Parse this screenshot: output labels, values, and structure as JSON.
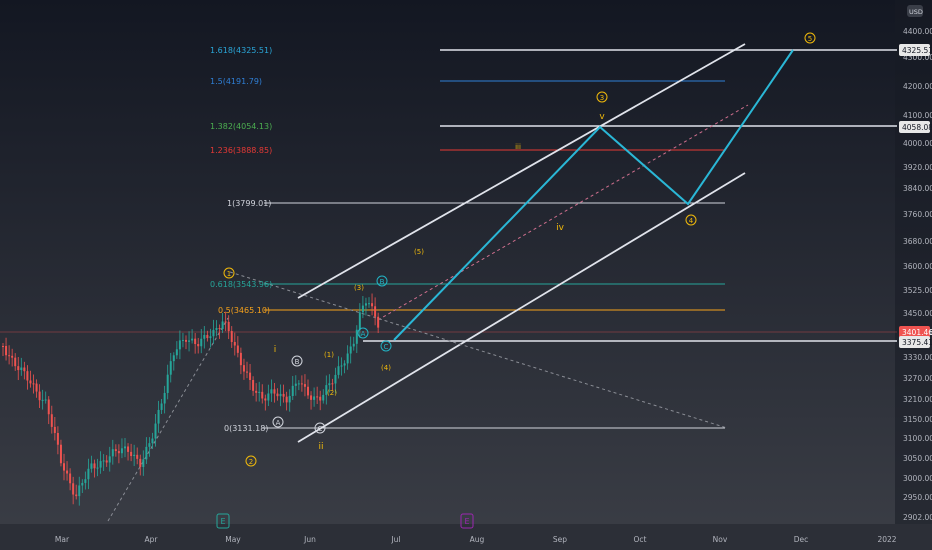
{
  "chart_data": {
    "type": "candlestick",
    "currency": "USD",
    "x_axis": {
      "labels": [
        "Mar",
        "Apr",
        "May",
        "Jun",
        "Jul",
        "Aug",
        "Sep",
        "Oct",
        "Nov",
        "Dec",
        "2022"
      ]
    },
    "y_axis": {
      "ticks": [
        "2902.00",
        "2950.00",
        "3000.00",
        "3050.00",
        "3100.00",
        "3150.00",
        "3210.00",
        "3270.00",
        "3330.00",
        "3400.00",
        "3450.00",
        "3525.00",
        "3600.00",
        "3680.00",
        "3760.00",
        "3840.00",
        "3920.00",
        "4000.00",
        "4100.00",
        "4200.00",
        "4300.00",
        "4400.00"
      ],
      "price_labels": [
        {
          "text": "4325.51",
          "style": "white"
        },
        {
          "text": "4058.08",
          "style": "white"
        },
        {
          "text": "3401.46",
          "style": "red"
        },
        {
          "text": "3375.41",
          "style": "white"
        }
      ]
    },
    "fib_levels": [
      {
        "label": "1.618(4325.51)",
        "color": "#2aa6d8"
      },
      {
        "label": "1.5(4191.79)",
        "color": "#2f7fd6"
      },
      {
        "label": "1.382(4054.13)",
        "color": "#4caf50"
      },
      {
        "label": "1.236(3888.85)",
        "color": "#e53935"
      },
      {
        "label": "1(3799.01)",
        "color": "#d1d4dc"
      },
      {
        "label": "0.618(3543.96)",
        "color": "#26a69a"
      },
      {
        "label": "0.5(3465.10)",
        "color": "#f7a21b"
      },
      {
        "label": "0(3131.18)",
        "color": "#d1d4dc"
      }
    ],
    "wave_labels": [
      {
        "text": "1",
        "circle": true,
        "color": "#f0b90b"
      },
      {
        "text": "2",
        "circle": true,
        "color": "#f0b90b"
      },
      {
        "text": "3",
        "circle": true,
        "color": "#f0b90b"
      },
      {
        "text": "4",
        "circle": true,
        "color": "#f0b90b"
      },
      {
        "text": "5",
        "circle": true,
        "color": "#f0b90b"
      },
      {
        "text": "A",
        "circle": true,
        "color": "#d1d4dc"
      },
      {
        "text": "B",
        "circle": true,
        "color": "#d1d4dc"
      },
      {
        "text": "C",
        "circle": true,
        "color": "#d1d4dc"
      },
      {
        "text": "A",
        "circle": true,
        "color": "#22b3c4"
      },
      {
        "text": "B",
        "circle": true,
        "color": "#22b3c4"
      },
      {
        "text": "C",
        "circle": true,
        "color": "#22b3c4"
      },
      {
        "text": "i",
        "circle": false,
        "color": "#f0b90b"
      },
      {
        "text": "ii",
        "circle": false,
        "color": "#f0b90b"
      },
      {
        "text": "iii",
        "circle": false,
        "color": "#f0b90b"
      },
      {
        "text": "iv",
        "circle": false,
        "color": "#f0b90b"
      },
      {
        "text": "v",
        "circle": false,
        "color": "#f0b90b"
      },
      {
        "text": "(1)",
        "circle": false,
        "color": "#f0b90b"
      },
      {
        "text": "(2)",
        "circle": false,
        "color": "#f0b90b"
      },
      {
        "text": "(3)",
        "circle": false,
        "color": "#f0b90b"
      },
      {
        "text": "(4)",
        "circle": false,
        "color": "#f0b90b"
      },
      {
        "text": "(5)",
        "circle": false,
        "color": "#f0b90b"
      }
    ],
    "event_markers": [
      {
        "text": "E",
        "color": "#26a69a"
      },
      {
        "text": "E",
        "color": "#9c27b0"
      }
    ],
    "colors": {
      "up": "#26a69a",
      "down": "#ef5350",
      "projection": "#2ab7d6",
      "channel": "#e0e3eb",
      "bg_top": "#131722",
      "bg_bottom": "#3a3d45",
      "axis_text": "#b2b5be"
    }
  }
}
